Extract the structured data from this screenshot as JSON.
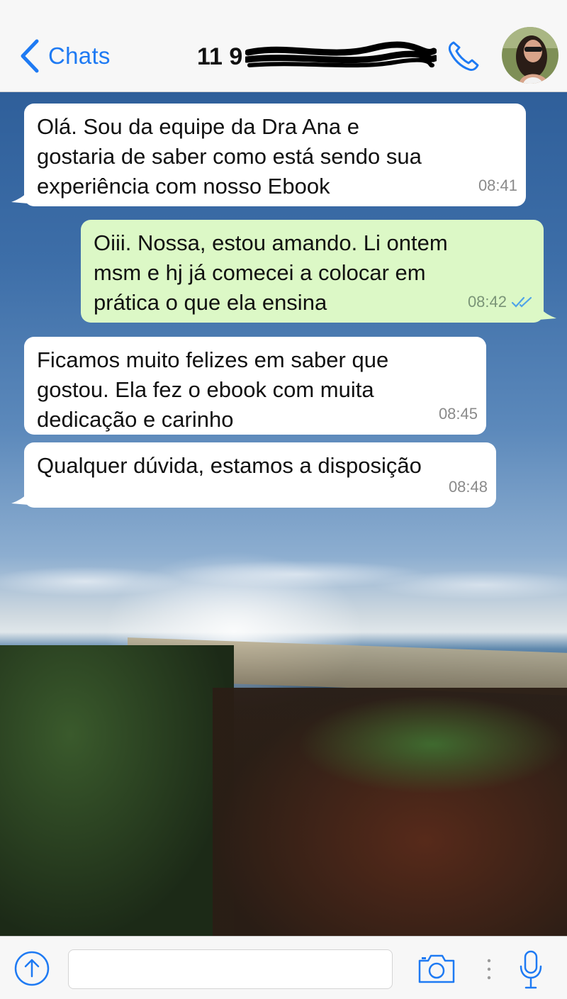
{
  "header": {
    "back_label": "Chats",
    "contact_name_visible": "11 9",
    "contact_name_redacted": true
  },
  "messages": [
    {
      "direction": "in",
      "text": "Olá. Sou da equipe da Dra Ana e\ngostaria de saber como está sendo sua\nexperiência com nosso Ebook",
      "time": "08:41"
    },
    {
      "direction": "out",
      "text": "Oiii. Nossa, estou amando. Li ontem\nmsm e hj já comecei a colocar em\nprática o que ela ensina",
      "time": "08:42",
      "status": "read"
    },
    {
      "direction": "in",
      "text": "Ficamos muito felizes em saber que\ngostou. Ela fez o ebook com muita\ndedicação e carinho",
      "time": "08:45"
    },
    {
      "direction": "in",
      "text": "Qualquer dúvida, estamos a disposição",
      "time": "08:48"
    }
  ],
  "composer": {
    "value": "",
    "placeholder": ""
  },
  "colors": {
    "accent": "#1e7af3",
    "incoming_bubble": "#ffffff",
    "outgoing_bubble": "#dcf8c6",
    "read_ticks": "#4fa3e8"
  },
  "icons": {
    "back": "chevron-left-icon",
    "call": "phone-icon",
    "upload": "upload-arrow-icon",
    "camera": "camera-icon",
    "more": "vertical-dots-icon",
    "mic": "microphone-icon"
  }
}
